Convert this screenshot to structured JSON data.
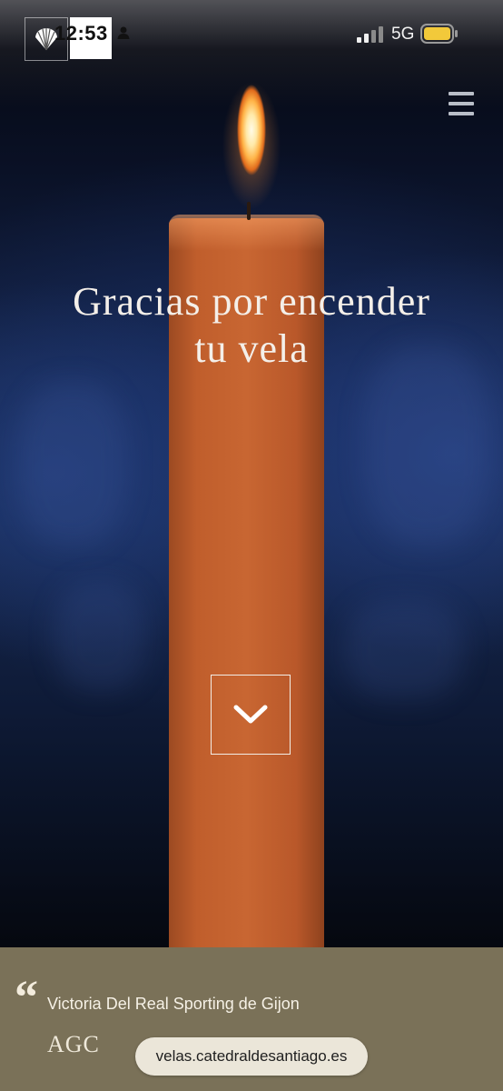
{
  "status_bar": {
    "time": "12:53",
    "network": "5G",
    "icons": [
      "scallop-shell-logo",
      "person-icon",
      "signal-icon",
      "battery-icon"
    ]
  },
  "header": {
    "menu_icon": "hamburger-menu-icon"
  },
  "hero": {
    "headline_line1": "Gracias por encender",
    "headline_line2": "tu vela",
    "scroll_icon": "chevron-down-icon"
  },
  "footer": {
    "quote_mark": "“",
    "dedication": "Victoria Del Real Sporting de Gijon",
    "brand": "AGC"
  },
  "browser": {
    "url": "velas.catedraldesantiago.es"
  },
  "colors": {
    "footer_bg": "#7a7158",
    "candle": "#c05e2c",
    "background": "#16284f"
  }
}
